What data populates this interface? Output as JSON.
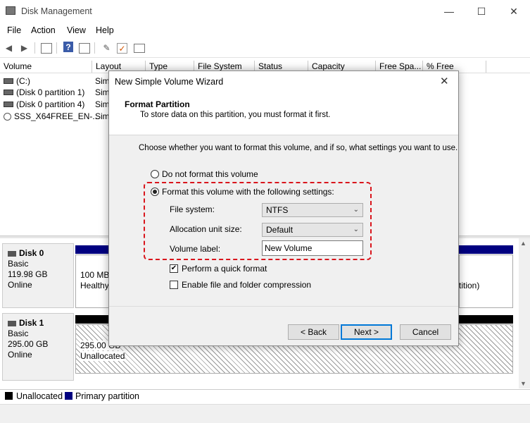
{
  "window": {
    "title": "Disk Management"
  },
  "menu": [
    "File",
    "Action",
    "View",
    "Help"
  ],
  "volume_table": {
    "columns": [
      "Volume",
      "Layout",
      "Type",
      "File System",
      "Status",
      "Capacity",
      "Free Spa...",
      "% Free"
    ],
    "rows": [
      {
        "volume": "(C:)",
        "layout": "Sim"
      },
      {
        "volume": "(Disk 0 partition 1)",
        "layout": "Sim"
      },
      {
        "volume": "(Disk 0 partition 4)",
        "layout": "Sim"
      },
      {
        "volume": "SSS_X64FREE_EN-...",
        "layout": "Sim"
      }
    ]
  },
  "disks": [
    {
      "name": "Disk 0",
      "type": "Basic",
      "size": "119.98 GB",
      "status": "Online",
      "partition_text_1": "100 MB",
      "partition_text_2": "Healthy",
      "right_text": "tition)"
    },
    {
      "name": "Disk 1",
      "type": "Basic",
      "size": "295.00 GB",
      "status": "Online",
      "partition_text_1": "295.00 GB",
      "partition_text_2": "Unallocated"
    }
  ],
  "legend": [
    {
      "label": "Unallocated",
      "color": "#000000"
    },
    {
      "label": "Primary partition",
      "color": "#000080"
    }
  ],
  "dialog": {
    "title": "New Simple Volume Wizard",
    "header_title": "Format Partition",
    "header_subtitle": "To store data on this partition, you must format it first.",
    "instruction": "Choose whether you want to format this volume, and if so, what settings you want to use.",
    "radio_no_format": "Do not format this volume",
    "radio_format": "Format this volume with the following settings:",
    "selected_option": "format",
    "file_system_label": "File system:",
    "file_system_value": "NTFS",
    "allocation_label": "Allocation unit size:",
    "allocation_value": "Default",
    "volume_label_label": "Volume label:",
    "volume_label_value": "New Volume",
    "quick_format_label": "Perform a quick format",
    "quick_format_checked": true,
    "compression_label": "Enable file and folder compression",
    "compression_checked": false,
    "back_button": "< Back",
    "next_button": "Next >",
    "cancel_button": "Cancel"
  },
  "colors": {
    "accent": "#0078d7",
    "primary_partition": "#000080",
    "highlight_box": "#d9151c"
  }
}
